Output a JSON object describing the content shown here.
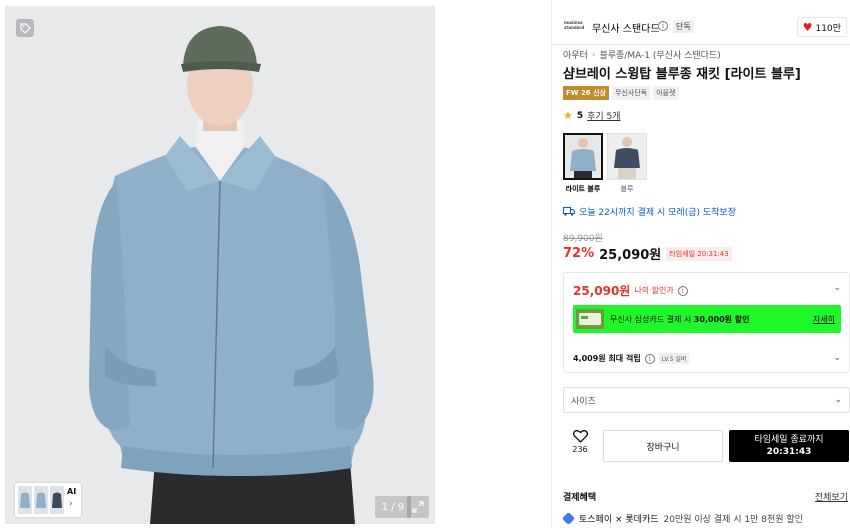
{
  "gallery": {
    "counter": "1 / 9",
    "ai_label": "AI",
    "ai_arrow": "›"
  },
  "brand": {
    "logo_text": "musinsa standard",
    "name": "무신사 스탠다드",
    "exclusive": "단독",
    "like_count": "110만"
  },
  "breadcrumb": [
    "아우터",
    "블루종/MA-1 (무신사 스탠다드)"
  ],
  "breadcrumb_sep": "›",
  "product": {
    "title": "샴브레이 스윙탑 블루종 재킷 [라이트 블루]",
    "tags": [
      "FW 26 신상",
      "무신사단독",
      "아울렛"
    ],
    "rating": "5",
    "review": "후기 5개"
  },
  "colors": [
    {
      "label": "라이트 블루",
      "selected": true
    },
    {
      "label": "블루",
      "selected": false
    }
  ],
  "delivery": "오늘 22시까지 결제 시 모레(금) 도착보장",
  "price": {
    "original": "89,900원",
    "discount": "72%",
    "sale": "25,090원",
    "timesale": "타임세일 20:31:43"
  },
  "benefits": {
    "my_price": "25,090원",
    "my_price_label": "나의 할인가",
    "card_text_pre": "무신사 삼성카드 결제 시 ",
    "card_text_bold": "30,000원 할인",
    "card_more": "자세히",
    "points_bold": "4,009원 최대 적립",
    "level": "LV.5 실버"
  },
  "size": {
    "placeholder": "사이즈"
  },
  "actions": {
    "like_count": "236",
    "cart": "장바구니",
    "buy_line1": "타임세일 종료까지",
    "buy_line2": "20:31:43"
  },
  "payment": {
    "title": "결제혜택",
    "view_all": "전체보기",
    "row_text": "토스페이 × 롯데카드",
    "row_sub": "20만원 이상 결제 시 1만 8천원 할인"
  },
  "colors_theme": {
    "accent_red": "#e5322d",
    "delivery_blue": "#0a58d8",
    "banner_green": "#1ff72a",
    "badge_gold": "#c28b2e"
  }
}
